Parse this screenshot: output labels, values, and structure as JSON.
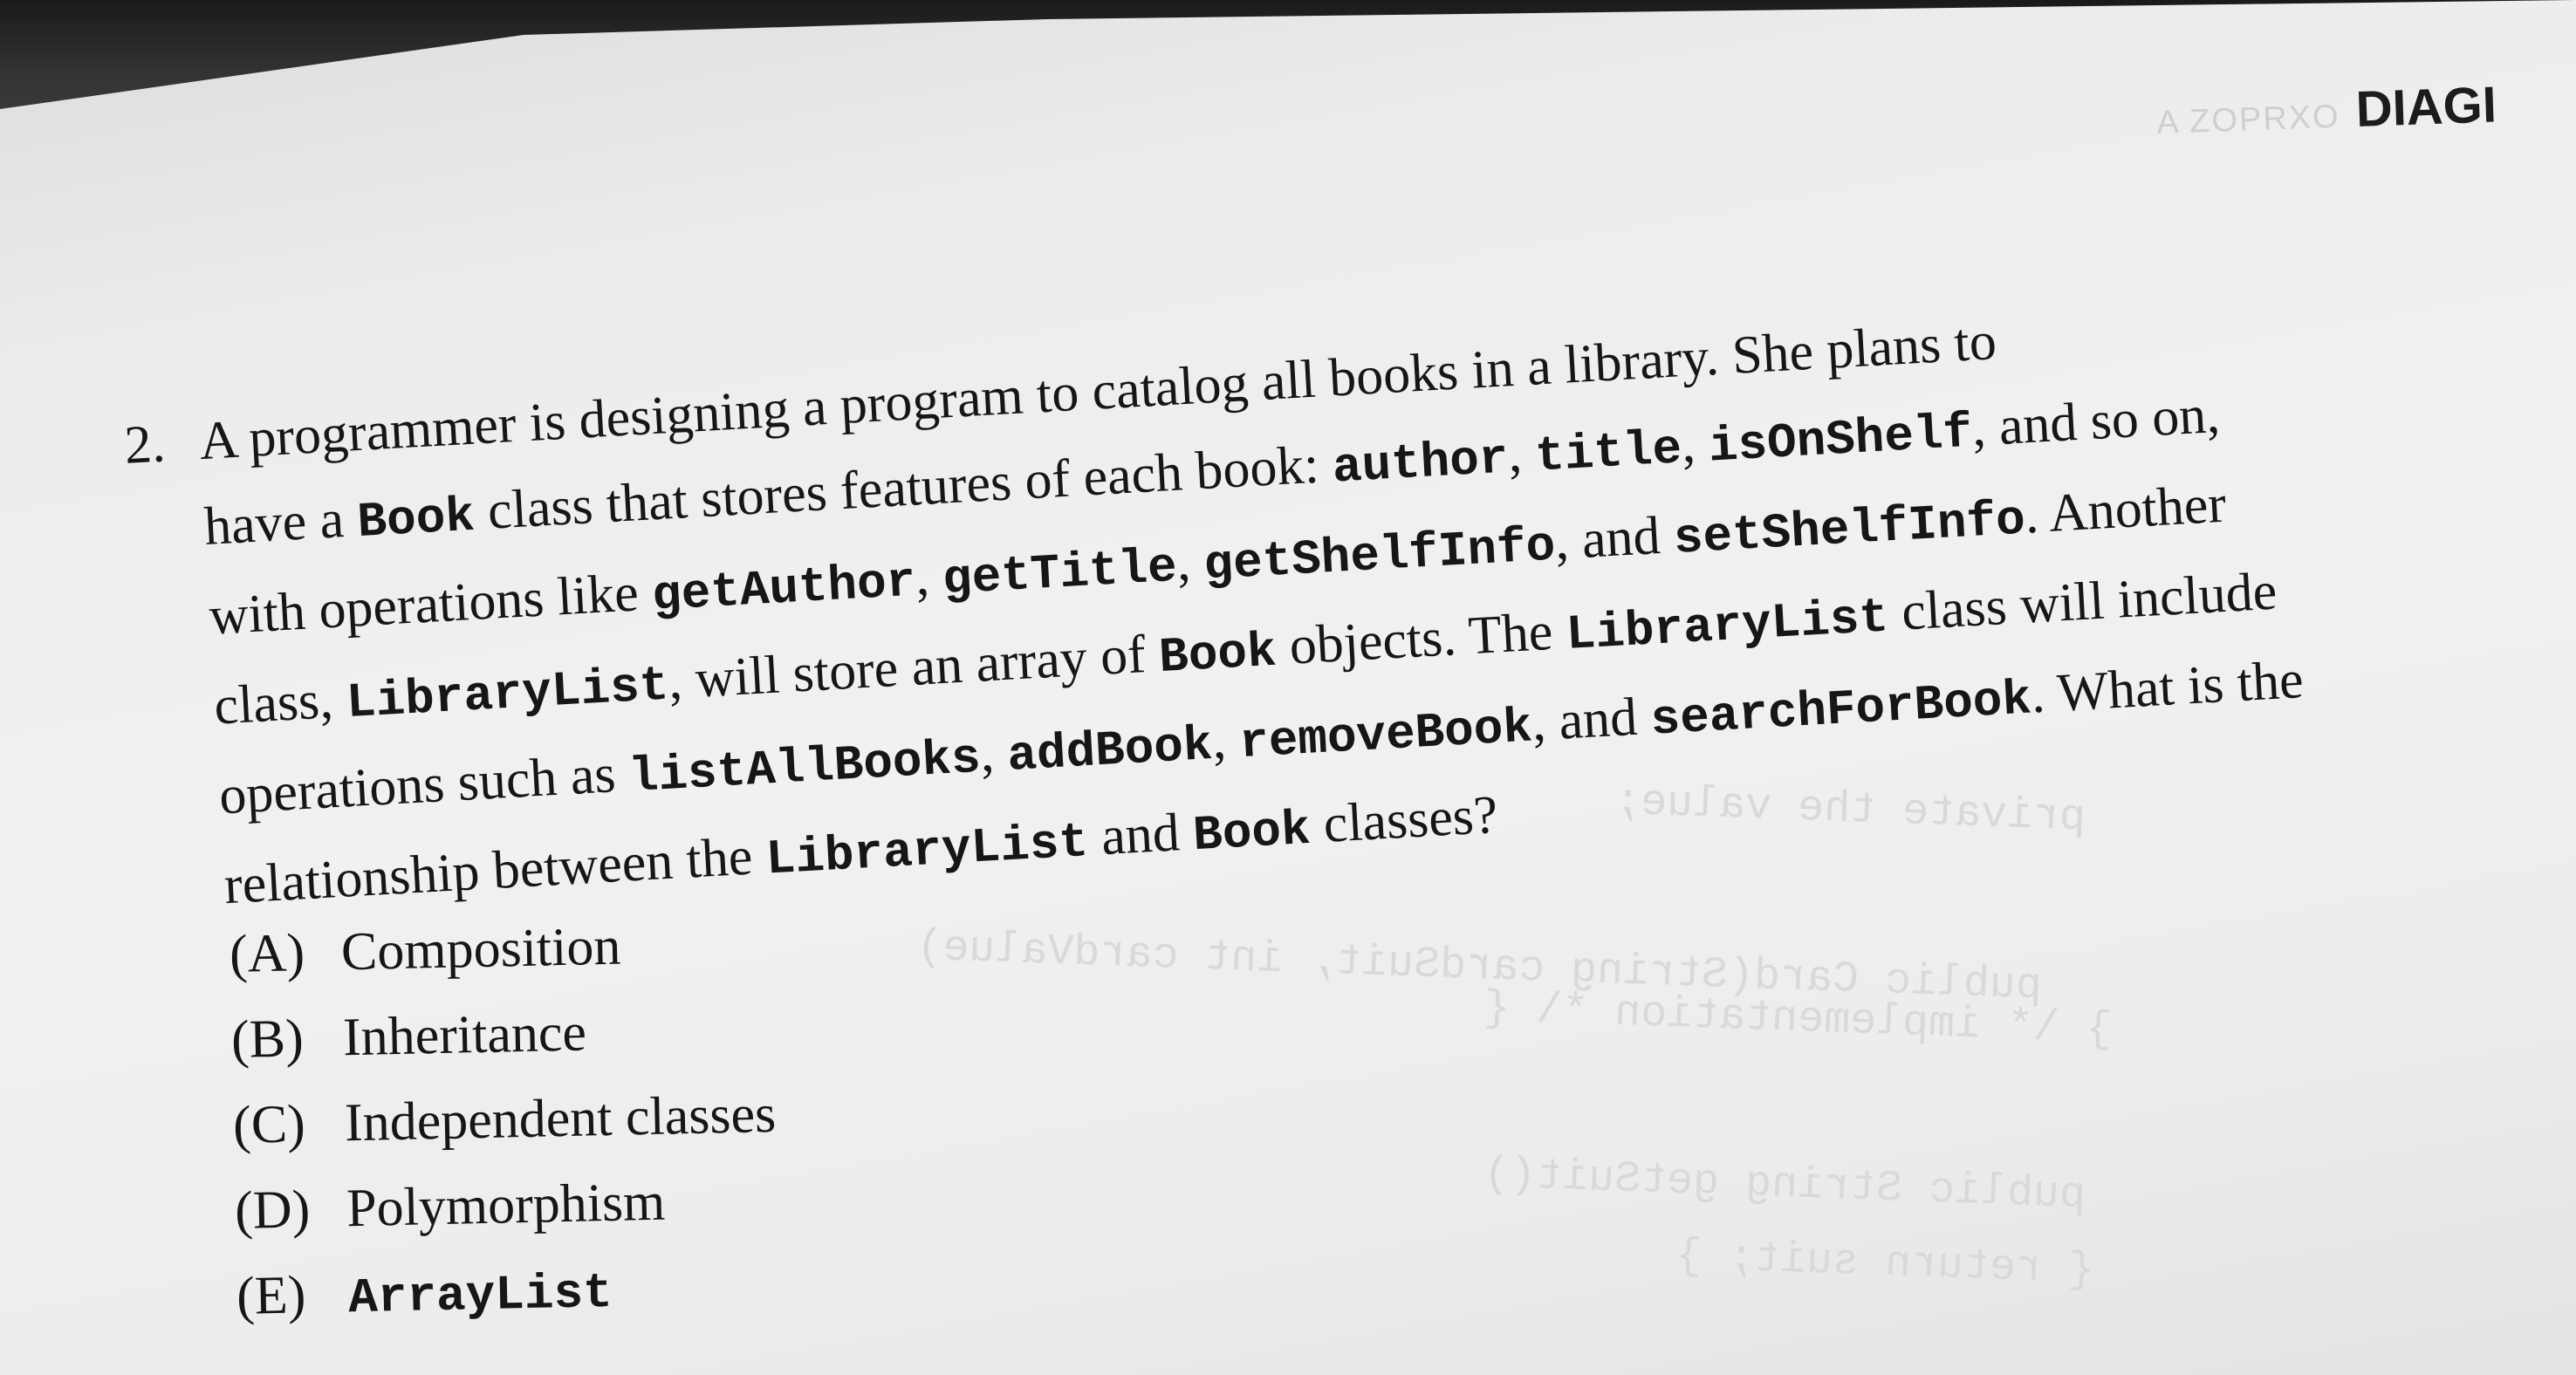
{
  "header": {
    "faint_text": "A ZOPRXO",
    "label": "DIAGI"
  },
  "question": {
    "number": "2.",
    "lines": [
      [
        {
          "t": "A programmer is designing a program to catalog all books in a library.  She plans to"
        }
      ],
      [
        {
          "t": "have a "
        },
        {
          "c": "Book"
        },
        {
          "t": " class that stores features of each book: "
        },
        {
          "c": "author"
        },
        {
          "t": ", "
        },
        {
          "c": "title"
        },
        {
          "t": ", "
        },
        {
          "c": "isOnShelf"
        },
        {
          "t": ", and so on,"
        }
      ],
      [
        {
          "t": "with operations like "
        },
        {
          "c": "getAuthor"
        },
        {
          "t": ", "
        },
        {
          "c": "getTitle"
        },
        {
          "t": ", "
        },
        {
          "c": "getShelfInfo"
        },
        {
          "t": ", and "
        },
        {
          "c": "setShelfInfo"
        },
        {
          "t": ".  Another"
        }
      ],
      [
        {
          "t": "class, "
        },
        {
          "c": "LibraryList"
        },
        {
          "t": ", will store an array of "
        },
        {
          "c": "Book"
        },
        {
          "t": " objects. The "
        },
        {
          "c": "LibraryList"
        },
        {
          "t": " class will include"
        }
      ],
      [
        {
          "t": "operations such as "
        },
        {
          "c": "listAllBooks"
        },
        {
          "t": ", "
        },
        {
          "c": "addBook"
        },
        {
          "t": ", "
        },
        {
          "c": "removeBook"
        },
        {
          "t": ", and "
        },
        {
          "c": "searchForBook"
        },
        {
          "t": ". What is the"
        }
      ],
      [
        {
          "t": "relationship between the "
        },
        {
          "c": "LibraryList"
        },
        {
          "t": " and "
        },
        {
          "c": "Book"
        },
        {
          "t": " classes?"
        }
      ]
    ]
  },
  "choices": [
    {
      "letter": "(A)",
      "text": "Composition",
      "code": false
    },
    {
      "letter": "(B)",
      "text": "Inheritance",
      "code": false
    },
    {
      "letter": "(C)",
      "text": "Independent classes",
      "code": false
    },
    {
      "letter": "(D)",
      "text": "Polymorphism",
      "code": false
    },
    {
      "letter": "(E)",
      "text": "ArrayList",
      "code": true
    }
  ]
}
